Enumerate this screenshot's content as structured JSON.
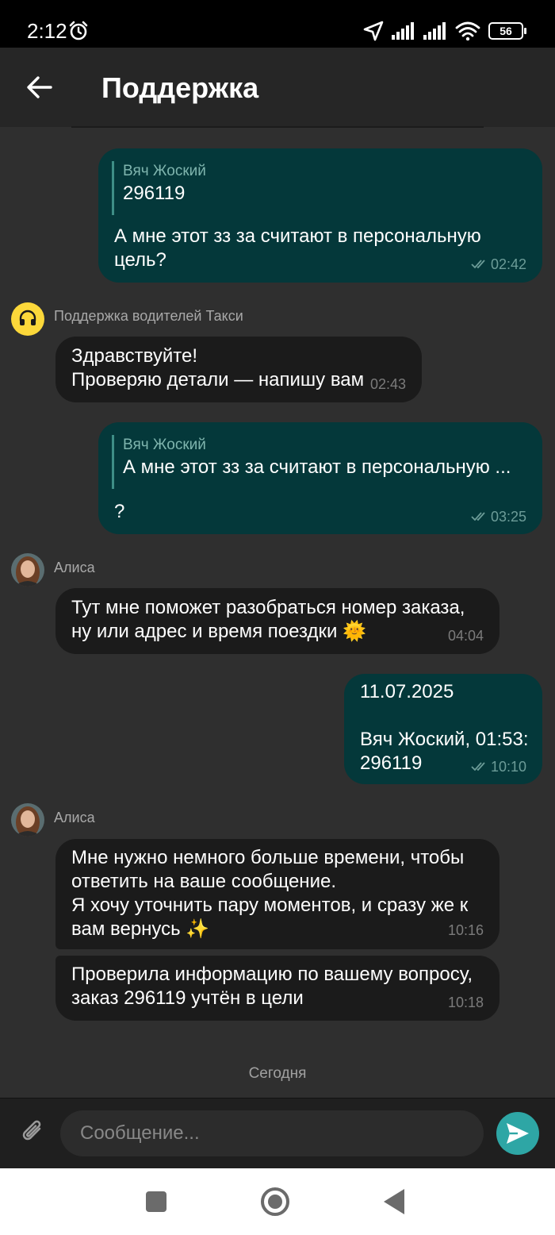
{
  "status_bar": {
    "time": "2:12",
    "battery": "56"
  },
  "header": {
    "title": "Поддержка"
  },
  "messages": [
    {
      "reply_name": "Вяч Жоский",
      "reply_text": "296119",
      "text": "А мне этот зз за считают в персональную\nцель?",
      "time": "02:42"
    },
    {
      "sender": "Поддержка водителей Такси",
      "text": "Здравствуйте!\nПроверяю детали — напишу вам",
      "time": "02:43"
    },
    {
      "reply_name": "Вяч Жоский",
      "reply_text": "А мне этот зз за считают в персональную ...",
      "text": "?",
      "time": "03:25"
    },
    {
      "sender": "Алиса",
      "text": "Тут мне поможет разобраться номер заказа,\nну или адрес и время поездки 🌞",
      "time": "04:04"
    },
    {
      "text": "11.07.2025\n\nВяч Жоский, 01:53:\n296119",
      "time": "10:10"
    },
    {
      "sender": "Алиса",
      "text": "Мне нужно немного больше времени, чтобы\nответить на ваше сообщение.\nЯ хочу уточнить пару моментов, и сразу же к\nвам вернусь ✨",
      "time": "10:16"
    },
    {
      "text": "Проверила информацию по вашему вопросу,\nзаказ 296119 учтён в цели",
      "time": "10:18"
    }
  ],
  "date_separator": "Сегодня",
  "composer": {
    "placeholder": "Сообщение..."
  },
  "colors": {
    "outgoing": "#04383a",
    "incoming": "#1b1b1b",
    "send": "#2ea6a5",
    "support_avatar": "#fcd83a"
  }
}
